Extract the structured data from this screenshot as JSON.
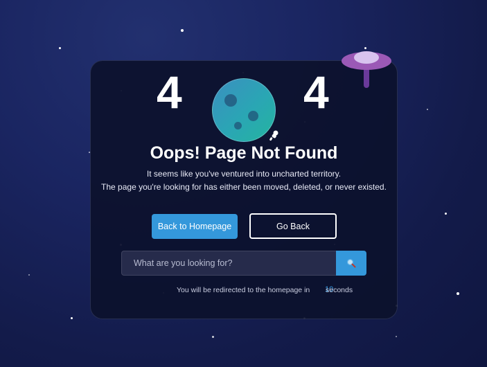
{
  "error": {
    "digit_left": "4",
    "digit_right": "4",
    "title": "Oops! Page Not Found",
    "message_line1": "It seems like you've ventured into uncharted territory.",
    "message_line2": "The page you're looking for has either been moved, deleted, or never existed."
  },
  "actions": {
    "home_label": "Back to Homepage",
    "back_label": "Go Back"
  },
  "search": {
    "placeholder": "What are you looking for?",
    "value": "",
    "icon": "magnifier-icon"
  },
  "redirect": {
    "prefix": "You will be redirected to the homepage in",
    "countdown": "10",
    "suffix": "seconds"
  },
  "icons": {
    "planet": "planet-icon",
    "ufo": "ufo-icon",
    "astronaut": "astronaut-icon"
  },
  "colors": {
    "accent": "#3498db",
    "background": "#1a2561",
    "card": "#0c112d",
    "planet": "#2aa6b4",
    "ufo": "#9b59b6"
  }
}
